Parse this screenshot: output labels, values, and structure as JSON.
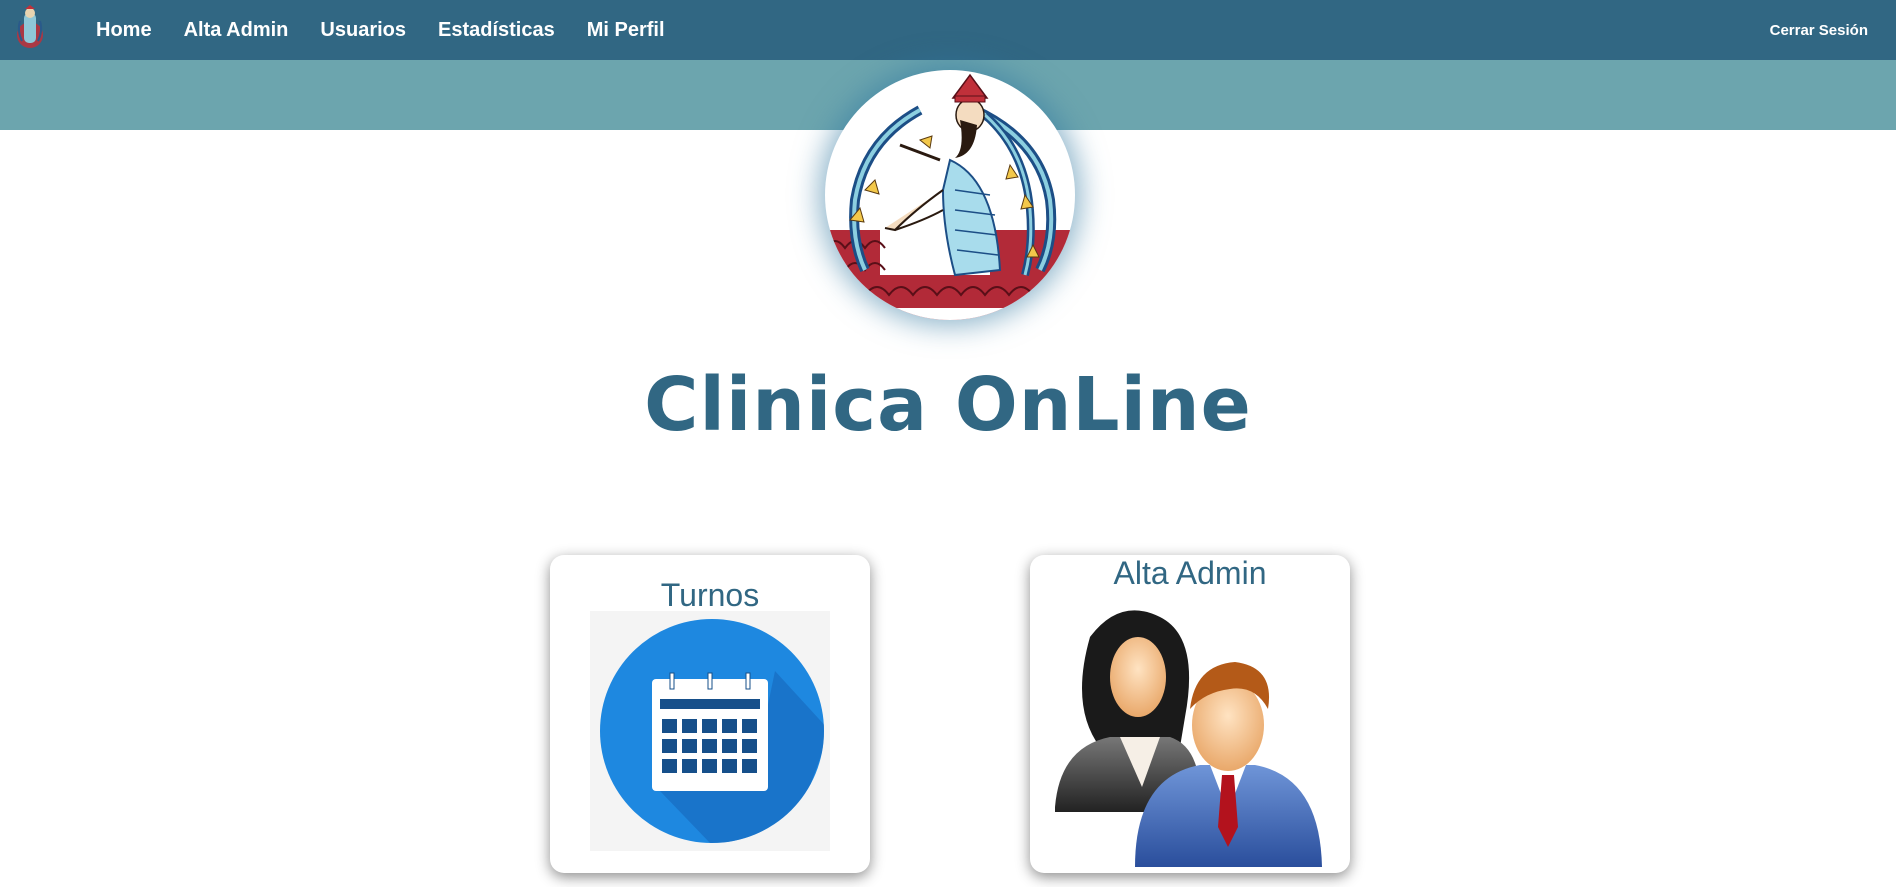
{
  "nav": {
    "links": [
      "Home",
      "Alta Admin",
      "Usuarios",
      "Estadísticas",
      "Mi Perfil"
    ],
    "logout": "Cerrar Sesión"
  },
  "main": {
    "title": "Clinica OnLine"
  },
  "cards": {
    "turnos": {
      "title": "Turnos",
      "icon": "calendar-icon"
    },
    "alta_admin": {
      "title": "Alta Admin",
      "icon": "users-icon"
    }
  },
  "colors": {
    "navbar": "#316783",
    "band": "#6ca5ae",
    "title": "#316783",
    "calendar_blue": "#1e88e0"
  }
}
